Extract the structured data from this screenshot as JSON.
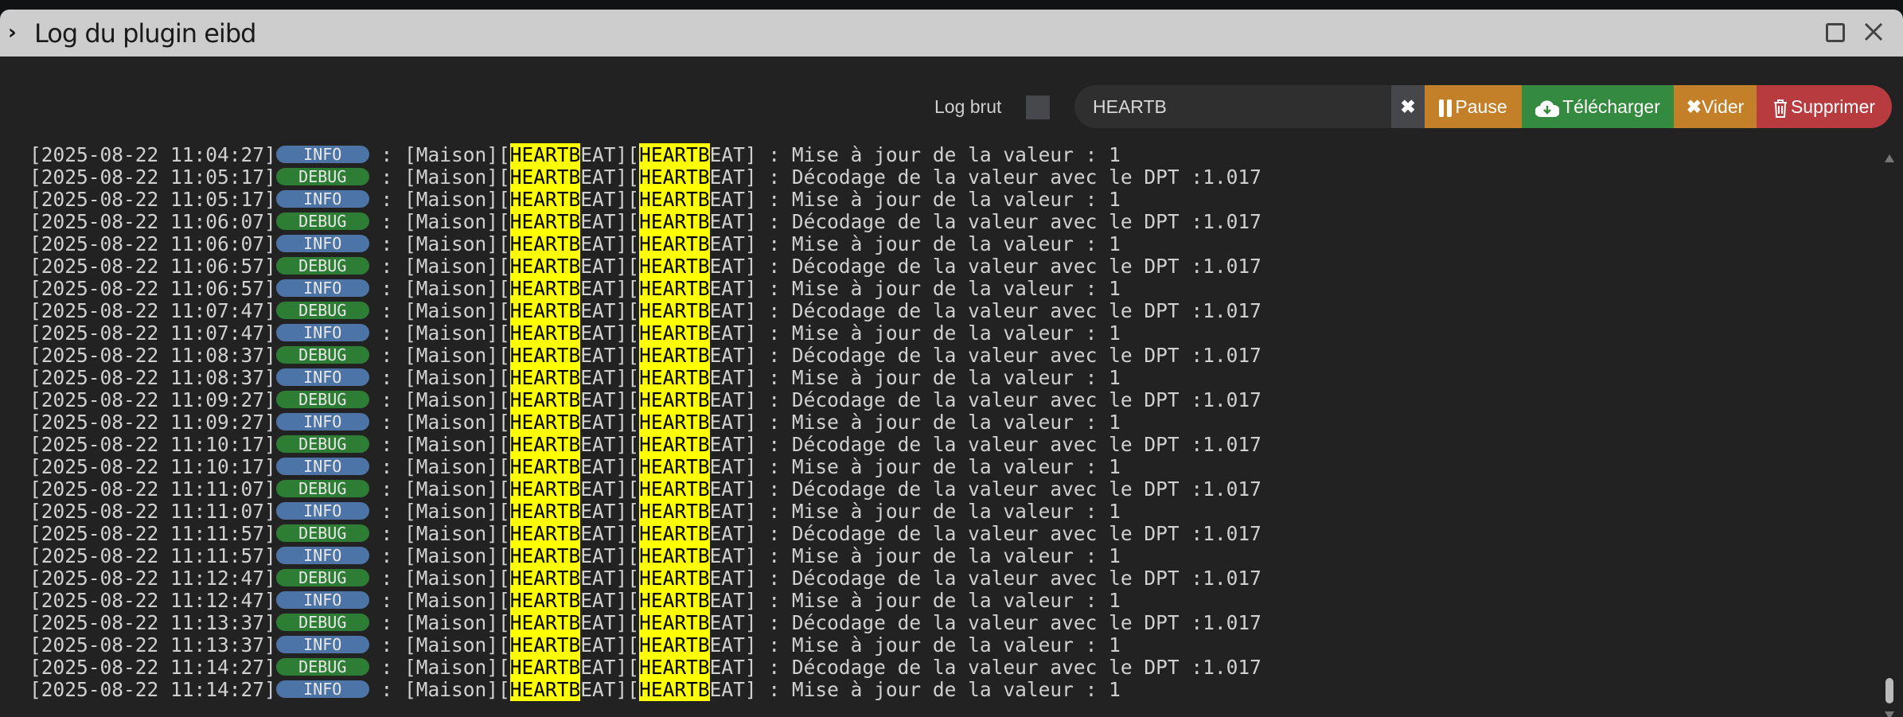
{
  "window": {
    "title": "Log du plugin eibd"
  },
  "toolbar": {
    "log_brut_label": "Log brut",
    "log_brut_checked": false,
    "search_value": "HEARTB",
    "clear_label": "✖",
    "pause_label": "Pause",
    "download_label": "Télécharger",
    "empty_label": "Vider",
    "delete_label": "Supprimer"
  },
  "colors": {
    "info": "#4d74a6",
    "debug": "#2e7d35",
    "highlight": "#ffff00",
    "pause": "#c47f29",
    "download": "#348a3e",
    "delete": "#b83b40"
  },
  "log": {
    "source": "Maison",
    "tag": "HEARTBEAT",
    "highlight": "HEARTB",
    "messages": {
      "INFO": "Mise à jour de la valeur : 1",
      "DEBUG": "Décodage de la valeur avec le DPT :1.017"
    },
    "rows": [
      {
        "ts": "2025-08-22 11:04:27",
        "level": "INFO"
      },
      {
        "ts": "2025-08-22 11:05:17",
        "level": "DEBUG"
      },
      {
        "ts": "2025-08-22 11:05:17",
        "level": "INFO"
      },
      {
        "ts": "2025-08-22 11:06:07",
        "level": "DEBUG"
      },
      {
        "ts": "2025-08-22 11:06:07",
        "level": "INFO"
      },
      {
        "ts": "2025-08-22 11:06:57",
        "level": "DEBUG"
      },
      {
        "ts": "2025-08-22 11:06:57",
        "level": "INFO"
      },
      {
        "ts": "2025-08-22 11:07:47",
        "level": "DEBUG"
      },
      {
        "ts": "2025-08-22 11:07:47",
        "level": "INFO"
      },
      {
        "ts": "2025-08-22 11:08:37",
        "level": "DEBUG"
      },
      {
        "ts": "2025-08-22 11:08:37",
        "level": "INFO"
      },
      {
        "ts": "2025-08-22 11:09:27",
        "level": "DEBUG"
      },
      {
        "ts": "2025-08-22 11:09:27",
        "level": "INFO"
      },
      {
        "ts": "2025-08-22 11:10:17",
        "level": "DEBUG"
      },
      {
        "ts": "2025-08-22 11:10:17",
        "level": "INFO"
      },
      {
        "ts": "2025-08-22 11:11:07",
        "level": "DEBUG"
      },
      {
        "ts": "2025-08-22 11:11:07",
        "level": "INFO"
      },
      {
        "ts": "2025-08-22 11:11:57",
        "level": "DEBUG"
      },
      {
        "ts": "2025-08-22 11:11:57",
        "level": "INFO"
      },
      {
        "ts": "2025-08-22 11:12:47",
        "level": "DEBUG"
      },
      {
        "ts": "2025-08-22 11:12:47",
        "level": "INFO"
      },
      {
        "ts": "2025-08-22 11:13:37",
        "level": "DEBUG"
      },
      {
        "ts": "2025-08-22 11:13:37",
        "level": "INFO"
      },
      {
        "ts": "2025-08-22 11:14:27",
        "level": "DEBUG"
      },
      {
        "ts": "2025-08-22 11:14:27",
        "level": "INFO"
      }
    ]
  }
}
